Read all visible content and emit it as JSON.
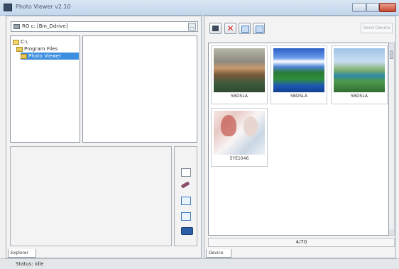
{
  "window": {
    "title": "Photo Viewer v2.10"
  },
  "left": {
    "path": "RO c: [Bin_Ddrive]",
    "path_button": "...",
    "tree": [
      {
        "label": "C:\\",
        "icon": "folder-open-icon"
      },
      {
        "label": "Program Files",
        "icon": "folder-icon"
      },
      {
        "label": "Photo Viewer",
        "icon": "folder-icon",
        "selected": true
      }
    ],
    "tools": [
      "frame-icon",
      "brush-icon",
      "image-icon",
      "picture-icon",
      "camera-icon"
    ],
    "tab_label": "Explorer"
  },
  "right": {
    "toolbar": {
      "save_icon": "save-icon",
      "delete_icon": "delete-icon",
      "prev_icon": "previous-image-icon",
      "next_icon": "next-image-icon",
      "delete_glyph": "✕",
      "send_label": "Send Device"
    },
    "thumbnails": [
      {
        "label": "5BDSLA",
        "scene": "landscape-dusk"
      },
      {
        "label": "5BDSLA",
        "scene": "landscape-blue-sky"
      },
      {
        "label": "5BDSLA",
        "scene": "landscape-river"
      },
      {
        "label": "5YE1046",
        "scene": "portrait-women"
      }
    ],
    "page_indicator": "4/70",
    "tab_label": "Device"
  },
  "status": {
    "text": "Status:   idle"
  },
  "colors": {
    "selection": "#3d8ee0",
    "close_button": "#c64630",
    "title_bar": "#c2d6ec"
  }
}
